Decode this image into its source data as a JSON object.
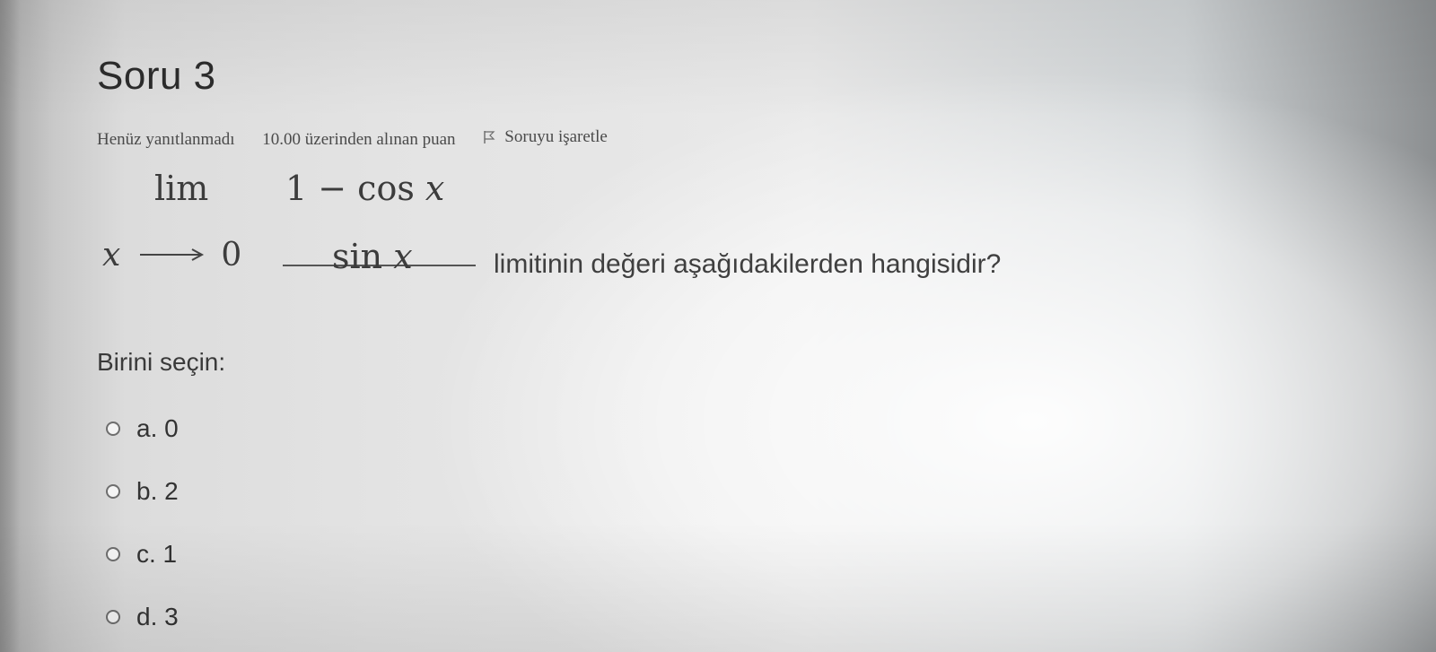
{
  "question": {
    "title": "Soru 3",
    "status": "Henüz yanıtlanmadı",
    "grade": "10.00 üzerinden alınan puan",
    "flag_label": "Soruyu işaretle",
    "math": {
      "lim": "lim",
      "var": "x",
      "limit_target": "0",
      "numerator_prefix": "1 − cos ",
      "denominator_prefix": "sin "
    },
    "prompt": "limitinin değeri aşağıdakilerden hangisidir?"
  },
  "answer": {
    "label": "Birini seçin:",
    "options": [
      {
        "label": "a. 0"
      },
      {
        "label": "b. 2"
      },
      {
        "label": "c. 1"
      },
      {
        "label": "d. 3"
      }
    ]
  },
  "icons": {
    "flag": "flag-icon",
    "radio": "radio-icon"
  }
}
